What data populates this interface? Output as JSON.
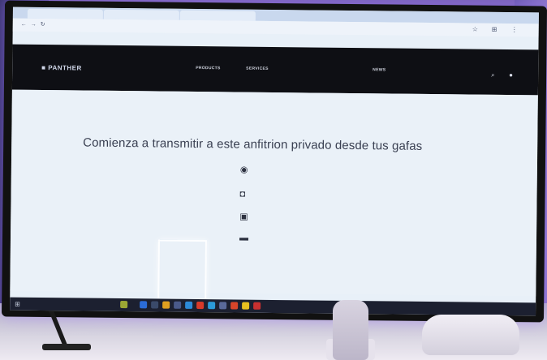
{
  "browser": {
    "tabs": [
      {
        "label": ""
      },
      {
        "label": ""
      },
      {
        "label": ""
      }
    ],
    "url": ""
  },
  "site": {
    "logo": "■ PANTHER",
    "nav": [
      "PRODUCTS",
      "SERVICES",
      "",
      "NEWS"
    ]
  },
  "main": {
    "headline": "Comienza a transmitir a este anfitrion privado desde tus gafas",
    "options": [
      {
        "icon": "headset-icon",
        "text": ""
      },
      {
        "icon": "camera-icon",
        "text": ""
      },
      {
        "icon": "devices-icon",
        "text": ""
      },
      {
        "icon": "monitor-icon",
        "text": ""
      }
    ],
    "footer_link": ""
  },
  "taskbar": {
    "search": "",
    "tray": ""
  },
  "colors": {
    "header_bg": "#0e0f14",
    "page_bg": "#eaf1f8",
    "ambient": "#7a63b8"
  }
}
